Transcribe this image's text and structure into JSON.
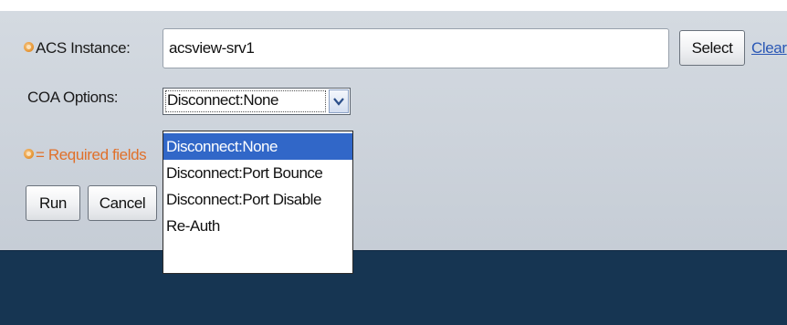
{
  "form": {
    "acs_label": "ACS Instance:",
    "acs_value": "acsview-srv1",
    "select_button": "Select",
    "clear_link": "Clear",
    "coa_label": "COA Options:",
    "coa_selected": "Disconnect:None",
    "required_note": "= Required fields",
    "run_button": "Run",
    "cancel_button": "Cancel"
  },
  "coa_options": [
    {
      "label": "Disconnect:None",
      "selected": true
    },
    {
      "label": "Disconnect:Port Bounce",
      "selected": false
    },
    {
      "label": "Disconnect:Port Disable",
      "selected": false
    },
    {
      "label": "Re-Auth",
      "selected": false
    }
  ],
  "icons": {
    "required_marker": "required-asterisk-icon",
    "dropdown_arrow": "chevron-down-icon"
  },
  "colors": {
    "panel_bg": "#c8cfd8",
    "footer_bg": "#163552",
    "required_text": "#e0702a",
    "link": "#2a57b5",
    "selection": "#3167c8"
  }
}
